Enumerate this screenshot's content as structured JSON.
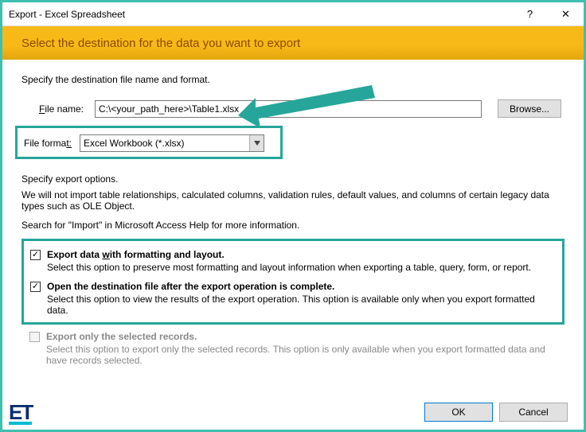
{
  "titlebar": {
    "title": "Export - Excel Spreadsheet",
    "help_icon": "?",
    "close_icon": "✕"
  },
  "banner": {
    "heading": "Select the destination for the data you want to export"
  },
  "dest": {
    "section_label": "Specify the destination file name and format.",
    "filename_label_pre": "F",
    "filename_label_post": "ile name:",
    "filename_value": "C:\\<your_path_here>\\Table1.xlsx",
    "browse_label": "Browse...",
    "fileformat_label_pre": "File forma",
    "fileformat_label_post": "t:",
    "fileformat_value": "Excel Workbook (*.xlsx)"
  },
  "options": {
    "section_label": "Specify export options.",
    "warning": "We will not import table relationships, calculated columns, validation rules, default values, and columns of certain legacy data types such as OLE Object.",
    "search_hint": "Search for \"Import\" in Microsoft Access Help for more information.",
    "opt1_title": "Export data with formatting and layout.",
    "opt1_desc": "Select this option to preserve most formatting and layout information when exporting a table, query, form, or report.",
    "opt2_title": "Open the destination file after the export operation is complete.",
    "opt2_desc": "Select this option to view the results of the export operation. This option is available only when you export formatted data.",
    "opt3_title": "Export only the selected records.",
    "opt3_desc": "Select this option to export only the selected records. This option is only available when you export formatted data and have records selected."
  },
  "buttons": {
    "ok": "OK",
    "cancel": "Cancel"
  },
  "logo": "ET"
}
